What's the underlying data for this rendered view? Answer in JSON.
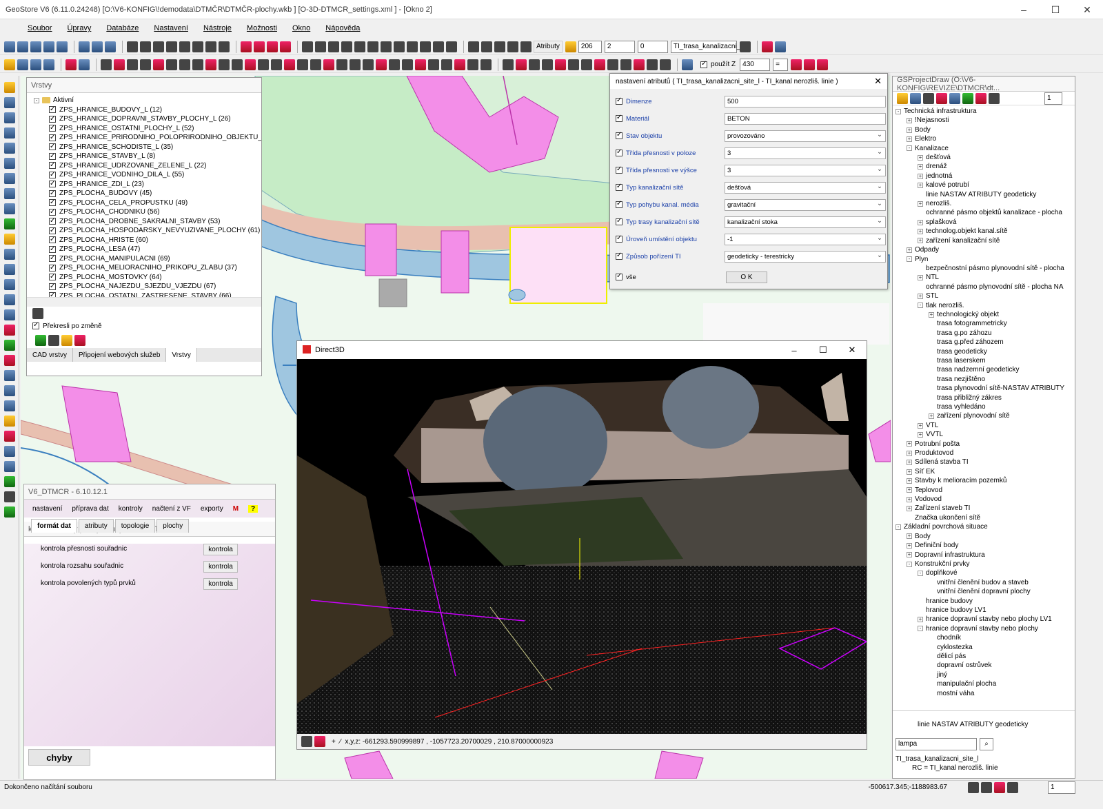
{
  "window": {
    "title": "GeoStore V6 (6.11.0.24248) [O:\\V6-KONFIG\\!demodata\\DTMČR\\DTMČR-plochy.wkb ] [O-3D-DTMCR_settings.xml ] - [Okno 2]"
  },
  "menu": [
    "Soubor",
    "Úpravy",
    "Databáze",
    "Nastavení",
    "Nástroje",
    "Možnosti",
    "Okno",
    "Nápověda"
  ],
  "toolbar": {
    "atributy": "Atributy",
    "field1": "206",
    "field2": "2",
    "field3": "0",
    "layer": "TI_trasa_kanalizacni_",
    "pouzitz": "použít Z",
    "zval": "430"
  },
  "layers_panel": {
    "title": "Vrstvy",
    "root": "Aktivní",
    "items": [
      "ZPS_HRANICE_BUDOVY_L (12)",
      "ZPS_HRANICE_DOPRAVNI_STAVBY_PLOCHY_L (26)",
      "ZPS_HRANICE_OSTATNI_PLOCHY_L (52)",
      "ZPS_HRANICE_PRIRODNIHO_POLOPRIRODNIHO_OBJEKTU_L",
      "ZPS_HRANICE_SCHODISTE_L (35)",
      "ZPS_HRANICE_STAVBY_L (8)",
      "ZPS_HRANICE_UDRZOVANE_ZELENE_L (22)",
      "ZPS_HRANICE_VODNIHO_DILA_L (55)",
      "ZPS_HRANICE_ZDI_L (23)",
      "ZPS_PLOCHA_BUDOVY (45)",
      "ZPS_PLOCHA_CELA_PROPUSTKU (49)",
      "ZPS_PLOCHA_CHODNIKU (56)",
      "ZPS_PLOCHA_DROBNE_SAKRALNI_STAVBY (53)",
      "ZPS_PLOCHA_HOSPODARSKY_NEVYUZIVANE_PLOCHY (61)",
      "ZPS_PLOCHA_HRISTE (60)",
      "ZPS_PLOCHA_LESA (47)",
      "ZPS_PLOCHA_MANIPULACNI (69)",
      "ZPS_PLOCHA_MELIORACNIHO_PRIKOPU_ZLABU (37)",
      "ZPS_PLOCHA_MOSTOVKY (64)",
      "ZPS_PLOCHA_NAJEZDU_SJEZDU_VJEZDU (67)",
      "ZPS_PLOCHA_OSTATNI_ZASTRESENE_STAVBY (66)"
    ],
    "redraw": "Překresli po změně",
    "tabs": [
      "CAD vrstvy",
      "Připojení webových služeb",
      "Vrstvy"
    ]
  },
  "attr_dialog": {
    "title": "nastavení atributů ( TI_trasa_kanalizacni_site_l - TI_kanal nerozliš. linie )",
    "rows": [
      {
        "label": "Dimenze",
        "value": "500"
      },
      {
        "label": "Materiál",
        "value": "BETON"
      },
      {
        "label": "Stav objektu",
        "value": "provozováno"
      },
      {
        "label": "Třída přesnosti v poloze",
        "value": "3"
      },
      {
        "label": "Třída přesnosti ve výšce",
        "value": "3"
      },
      {
        "label": "Typ kanalizační sítě",
        "value": "dešťová"
      },
      {
        "label": "Typ pohybu kanal. média",
        "value": "gravitační"
      },
      {
        "label": "Typ trasy kanalizační sítě",
        "value": "kanalizační stoka"
      },
      {
        "label": "Úroveň umístění objektu",
        "value": "-1"
      },
      {
        "label": "Způsob pořízení TI",
        "value": "geodeticky - terestricky"
      }
    ],
    "all": "vše",
    "ok": "O K"
  },
  "d3d": {
    "title": "Direct3D",
    "coords": "x,y,z: -661293.590999897 , -1057723.20700029 , 210.87000000923"
  },
  "right_panel": {
    "title": "GSProjectDraw  (O:\\V6-KONFIG\\REVIZE\\DTMCR\\dt...",
    "page": "1",
    "tree": [
      {
        "t": "Technická infrastruktura",
        "l": 0,
        "pm": "-"
      },
      {
        "t": "!Nejasnosti",
        "l": 1,
        "pm": "+"
      },
      {
        "t": "Body",
        "l": 1,
        "pm": "+"
      },
      {
        "t": "Elektro",
        "l": 1,
        "pm": "+"
      },
      {
        "t": "Kanalizace",
        "l": 1,
        "pm": "-"
      },
      {
        "t": "dešťová",
        "l": 2,
        "pm": "+"
      },
      {
        "t": "drenáž",
        "l": 2,
        "pm": "+"
      },
      {
        "t": "jednotná",
        "l": 2,
        "pm": "+"
      },
      {
        "t": "kalové potrubí",
        "l": 2,
        "pm": "+"
      },
      {
        "t": "linie NASTAV ATRIBUTY geodeticky",
        "l": 2,
        "pm": ""
      },
      {
        "t": "nerozliš.",
        "l": 2,
        "pm": "+"
      },
      {
        "t": "ochranné pásmo objektů kanalizace - plocha",
        "l": 2,
        "pm": ""
      },
      {
        "t": "splašková",
        "l": 2,
        "pm": "+"
      },
      {
        "t": "technolog.objekt kanal.sítě",
        "l": 2,
        "pm": "+"
      },
      {
        "t": "zařízení kanalizační sítě",
        "l": 2,
        "pm": "+"
      },
      {
        "t": "Odpady",
        "l": 1,
        "pm": "+"
      },
      {
        "t": "Plyn",
        "l": 1,
        "pm": "-"
      },
      {
        "t": "bezpečnostní pásmo plynovodní sítě - plocha",
        "l": 2,
        "pm": ""
      },
      {
        "t": "NTL",
        "l": 2,
        "pm": "+"
      },
      {
        "t": "ochranné pásmo plynovodní sítě - plocha NA",
        "l": 2,
        "pm": ""
      },
      {
        "t": "STL",
        "l": 2,
        "pm": "+"
      },
      {
        "t": "tlak nerozliš.",
        "l": 2,
        "pm": "-"
      },
      {
        "t": "technologický objekt",
        "l": 3,
        "pm": "+"
      },
      {
        "t": "trasa fotogrammetricky",
        "l": 3,
        "pm": ""
      },
      {
        "t": "trasa g.po záhozu",
        "l": 3,
        "pm": ""
      },
      {
        "t": "trasa g.před záhozem",
        "l": 3,
        "pm": ""
      },
      {
        "t": "trasa geodeticky",
        "l": 3,
        "pm": ""
      },
      {
        "t": "trasa laserskem",
        "l": 3,
        "pm": ""
      },
      {
        "t": "trasa nadzemní geodeticky",
        "l": 3,
        "pm": ""
      },
      {
        "t": "trasa nezjištěno",
        "l": 3,
        "pm": ""
      },
      {
        "t": "trasa plynovodní sítě-NASTAV ATRIBUTY",
        "l": 3,
        "pm": ""
      },
      {
        "t": "trasa přibližný zákres",
        "l": 3,
        "pm": ""
      },
      {
        "t": "trasa vyhledáno",
        "l": 3,
        "pm": ""
      },
      {
        "t": "zařízení plynovodní sítě",
        "l": 3,
        "pm": "+"
      },
      {
        "t": "VTL",
        "l": 2,
        "pm": "+"
      },
      {
        "t": "VVTL",
        "l": 2,
        "pm": "+"
      },
      {
        "t": "Potrubní pošta",
        "l": 1,
        "pm": "+"
      },
      {
        "t": "Produktovod",
        "l": 1,
        "pm": "+"
      },
      {
        "t": "Sdílená stavba TI",
        "l": 1,
        "pm": "+"
      },
      {
        "t": "Síť EK",
        "l": 1,
        "pm": "+"
      },
      {
        "t": "Stavby k melioracím pozemků",
        "l": 1,
        "pm": "+"
      },
      {
        "t": "Teplovod",
        "l": 1,
        "pm": "+"
      },
      {
        "t": "Vodovod",
        "l": 1,
        "pm": "+"
      },
      {
        "t": "Zařízení staveb TI",
        "l": 1,
        "pm": "+"
      },
      {
        "t": "Značka ukončení sítě",
        "l": 1,
        "pm": ""
      },
      {
        "t": "Základní povrchová situace",
        "l": 0,
        "pm": "-"
      },
      {
        "t": "Body",
        "l": 1,
        "pm": "+"
      },
      {
        "t": "Definiční body",
        "l": 1,
        "pm": "+"
      },
      {
        "t": "Dopravní infrastruktura",
        "l": 1,
        "pm": "+"
      },
      {
        "t": "Konstrukční prvky",
        "l": 1,
        "pm": "-"
      },
      {
        "t": "doplňkové",
        "l": 2,
        "pm": "-"
      },
      {
        "t": "vnitřní členění budov a staveb",
        "l": 3,
        "pm": ""
      },
      {
        "t": "vnitřní členění dopravní plochy",
        "l": 3,
        "pm": ""
      },
      {
        "t": "hranice budovy",
        "l": 2,
        "pm": ""
      },
      {
        "t": "hranice budovy LV1",
        "l": 2,
        "pm": ""
      },
      {
        "t": "hranice dopravní stavby nebo plochy LV1",
        "l": 2,
        "pm": "+"
      },
      {
        "t": "hranice dopravní stavby nebo plochy",
        "l": 2,
        "pm": "-"
      },
      {
        "t": "chodník",
        "l": 3,
        "pm": ""
      },
      {
        "t": "cyklostezka",
        "l": 3,
        "pm": ""
      },
      {
        "t": "dělicí pás",
        "l": 3,
        "pm": ""
      },
      {
        "t": "dopravní ostrůvek",
        "l": 3,
        "pm": ""
      },
      {
        "t": "jiný",
        "l": 3,
        "pm": ""
      },
      {
        "t": "manipulační plocha",
        "l": 3,
        "pm": ""
      },
      {
        "t": "mostní váha",
        "l": 3,
        "pm": ""
      }
    ],
    "preview": "linie NASTAV ATRIBUTY geodeticky",
    "search": "lampa",
    "bottom": [
      "TI_trasa_kanalizacni_site_l",
      "RC      = TI_kanal nerozliš. linie"
    ]
  },
  "dtm": {
    "title": "V6_DTMCR - 6.10.12.1",
    "menu": [
      "nastavení",
      "příprava dat",
      "kontroly",
      "načtení z VF",
      "exporty"
    ],
    "subtitle": "kontrolní úlohy pro výměnný formát DTM",
    "tabs": [
      "formát dat",
      "atributy",
      "topologie",
      "plochy"
    ],
    "checks": [
      "kontrola přesnosti souřadnic",
      "kontrola rozsahu souřadnic",
      "kontrola povolených typů prvků"
    ],
    "btn": "kontrola",
    "errors": "chyby"
  },
  "status": {
    "text": "Dokončeno načítání souboru",
    "coords": "-500617.345;-1188983.67",
    "zoom": "1"
  }
}
